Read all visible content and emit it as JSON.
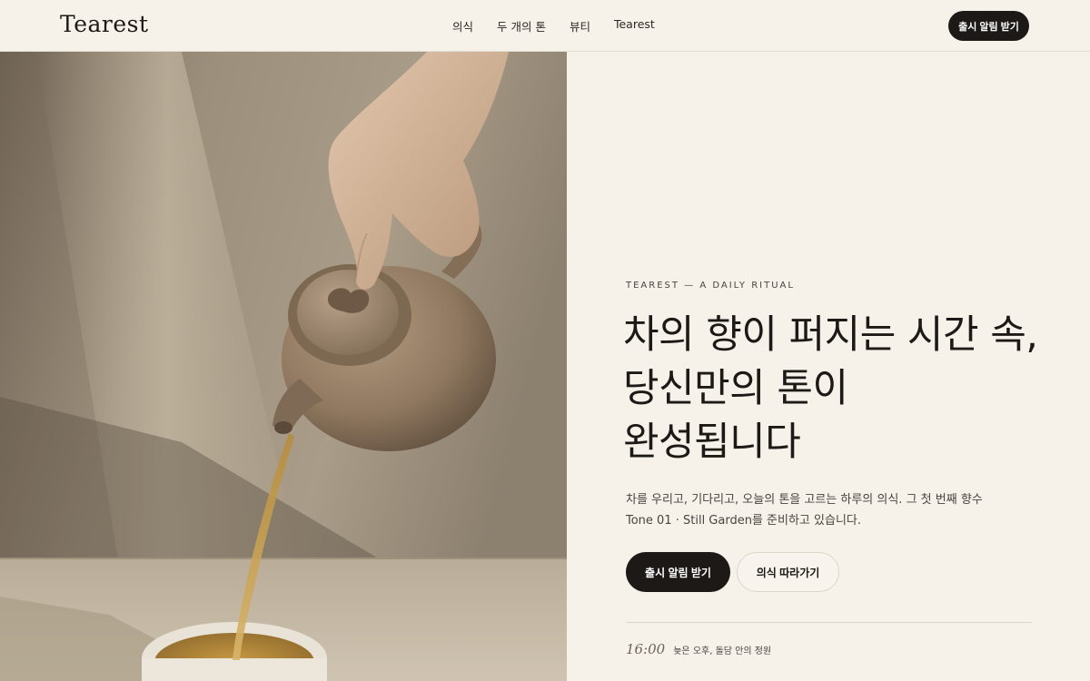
{
  "header": {
    "logo": "Tearest",
    "nav": [
      "의식",
      "두 개의 톤",
      "뷰티",
      "Tearest"
    ],
    "cta_label": "출시 알림 받기"
  },
  "hero": {
    "image_subject": "hand-pouring-tea-from-clay-teapot"
  },
  "content": {
    "eyebrow": "TEAREST — A DAILY RITUAL",
    "headline": [
      "차의 향이 퍼지는 시간 속,",
      "당신만의 톤이",
      "완성됩니다"
    ],
    "description": "차를 우리고, 기다리고, 오늘의 톤을 고르는 하루의 의식. 그 첫 번째 향수 Tone 01 · Still Garden를 준비하고 있습니다.",
    "primary_cta": "출시 알림 받기",
    "secondary_cta": "의식 따라가기",
    "time": "16:00",
    "time_caption": "늦은 오후, 돌담 안의 정원"
  },
  "colors": {
    "background": "#f6f1e9",
    "ink": "#1c1917",
    "muted": "#4a443e",
    "border": "#ddd5c9"
  }
}
